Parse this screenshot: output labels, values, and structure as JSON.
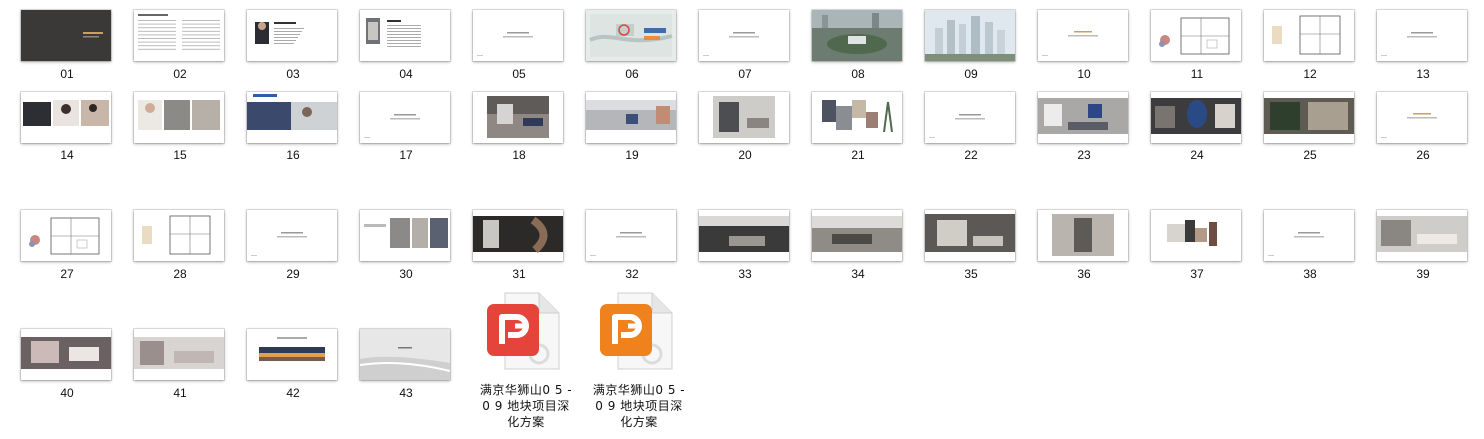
{
  "thumbnails": [
    {
      "label": "01",
      "style": "dark"
    },
    {
      "label": "02",
      "style": "text"
    },
    {
      "label": "03",
      "style": "portrait"
    },
    {
      "label": "04",
      "style": "portrait2"
    },
    {
      "label": "05",
      "style": "title"
    },
    {
      "label": "06",
      "style": "map"
    },
    {
      "label": "07",
      "style": "title"
    },
    {
      "label": "08",
      "style": "aerial"
    },
    {
      "label": "09",
      "style": "skyline"
    },
    {
      "label": "10",
      "style": "titlegold"
    },
    {
      "label": "11",
      "style": "plan"
    },
    {
      "label": "12",
      "style": "plan2"
    },
    {
      "label": "13",
      "style": "title"
    },
    {
      "label": "14",
      "style": "people"
    },
    {
      "label": "15",
      "style": "people2"
    },
    {
      "label": "16",
      "style": "people3"
    },
    {
      "label": "17",
      "style": "title"
    },
    {
      "label": "18",
      "style": "room"
    },
    {
      "label": "19",
      "style": "room2"
    },
    {
      "label": "20",
      "style": "room3"
    },
    {
      "label": "21",
      "style": "material"
    },
    {
      "label": "22",
      "style": "title"
    },
    {
      "label": "23",
      "style": "room4"
    },
    {
      "label": "24",
      "style": "room5"
    },
    {
      "label": "25",
      "style": "room6"
    },
    {
      "label": "26",
      "style": "titlegold"
    },
    {
      "label": "27",
      "style": "plan"
    },
    {
      "label": "28",
      "style": "plan2"
    },
    {
      "label": "29",
      "style": "title"
    },
    {
      "label": "30",
      "style": "people4"
    },
    {
      "label": "31",
      "style": "room7"
    },
    {
      "label": "32",
      "style": "title"
    },
    {
      "label": "33",
      "style": "room8"
    },
    {
      "label": "34",
      "style": "room9"
    },
    {
      "label": "35",
      "style": "room10"
    },
    {
      "label": "36",
      "style": "room11"
    },
    {
      "label": "37",
      "style": "material2"
    },
    {
      "label": "38",
      "style": "title"
    },
    {
      "label": "39",
      "style": "room12"
    },
    {
      "label": "40",
      "style": "room13"
    },
    {
      "label": "41",
      "style": "room14"
    },
    {
      "label": "42",
      "style": "sunset"
    },
    {
      "label": "43",
      "style": "beach"
    }
  ],
  "files": [
    {
      "name_lines": [
        "满京华狮山0 5 -",
        "0 9 地块项目深",
        "化方案"
      ],
      "color": "#e5443b",
      "icon": "wps-pdf-red-icon"
    },
    {
      "name_lines": [
        "满京华狮山0 5 -",
        "0 9 地块项目深",
        "化方案"
      ],
      "color": "#f0821e",
      "icon": "wps-pdf-orange-icon"
    }
  ]
}
